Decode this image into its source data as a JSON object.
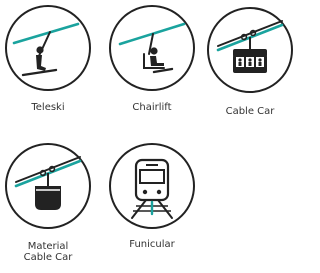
{
  "colors": {
    "outline": "#222222",
    "cable": "#1aa39e",
    "label": "#333333",
    "background": "#ffffff"
  },
  "icons": [
    {
      "id": "teleski",
      "icon": "teleski-icon",
      "label": "Teleski"
    },
    {
      "id": "chairlift",
      "icon": "chairlift-icon",
      "label": "Chairlift"
    },
    {
      "id": "cable-car",
      "icon": "cable-car-icon",
      "label": "Cable Car"
    },
    {
      "id": "material-cable-car",
      "icon": "material-cable-car-icon",
      "label": "Material\nCable Car"
    },
    {
      "id": "funicular",
      "icon": "funicular-icon",
      "label": "Funicular"
    }
  ]
}
